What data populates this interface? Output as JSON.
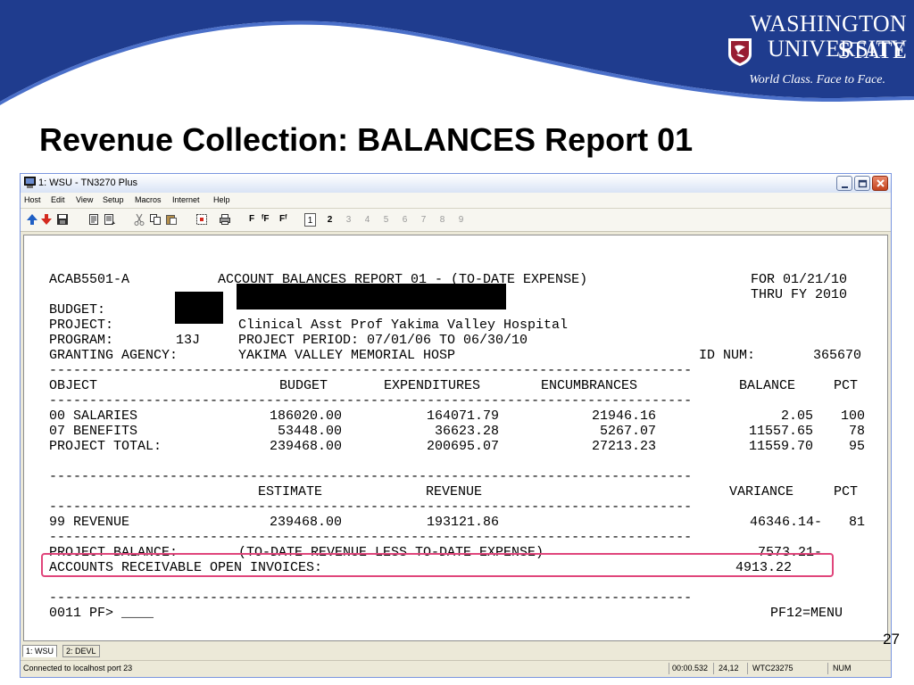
{
  "slide": {
    "title": "Revenue Collection: BALANCES Report 01",
    "page_number": "27",
    "logo": {
      "line1": "WASHINGTON STATE",
      "line2": "UNIVERSITY",
      "tagline": "World Class. Face to Face."
    },
    "colors": {
      "navy": "#1f3c8e",
      "crimson": "#981e32",
      "highlight": "#e0457b"
    }
  },
  "window": {
    "title": "1: WSU - TN3270 Plus",
    "menu": [
      "Host",
      "Edit",
      "View",
      "Setup",
      "Macros",
      "Internet",
      "Help"
    ],
    "toolbar": {
      "font_buttons": [
        "F",
        "ᶠF",
        "Fᶠ"
      ],
      "sessions": [
        "1",
        "2",
        "3",
        "4",
        "5",
        "6",
        "7",
        "8",
        "9"
      ]
    },
    "tabs": [
      "1: WSU",
      "2: DEVL"
    ],
    "status": {
      "connection": "Connected to localhost port 23",
      "time": "00:00.532",
      "cursor": "24,12",
      "device": "WTC23275",
      "numlock": "NUM"
    }
  },
  "terminal": {
    "header": {
      "report_id": "ACAB5501-A",
      "report_title": "ACCOUNT BALANCES REPORT 01 - (TO-DATE EXPENSE)",
      "for_date": "FOR 01/21/10",
      "thru": "THRU FY 2010"
    },
    "budget_label": "BUDGET:",
    "project_label": "PROJECT:",
    "project_desc": "Clinical Asst Prof Yakima Valley Hospital",
    "program_label": "PROGRAM:",
    "program_code": "13J",
    "project_period": "PROJECT PERIOD: 07/01/06 TO 06/30/10",
    "granting_label": "GRANTING AGENCY:",
    "granting_agency": "YAKIMA VALLEY MEMORIAL HOSP",
    "id_label": "ID NUM:",
    "id_num": "365670",
    "divider": "--------------------------------------------------------------------------------",
    "expense_columns": {
      "object": "OBJECT",
      "budget": "BUDGET",
      "expenditures": "EXPENDITURES",
      "encumbrances": "ENCUMBRANCES",
      "balance": "BALANCE",
      "pct": "PCT"
    },
    "expense_rows": [
      {
        "object": "00 SALARIES",
        "budget": "186020.00",
        "expenditures": "164071.79",
        "encumbrances": "21946.16",
        "balance": "2.05",
        "pct": "100"
      },
      {
        "object": "07 BENEFITS",
        "budget": "53448.00",
        "expenditures": "36623.28",
        "encumbrances": "5267.07",
        "balance": "11557.65",
        "pct": "78"
      },
      {
        "object": "PROJECT TOTAL:",
        "budget": "239468.00",
        "expenditures": "200695.07",
        "encumbrances": "27213.23",
        "balance": "11559.70",
        "pct": "95"
      }
    ],
    "revenue_columns": {
      "estimate": "ESTIMATE",
      "revenue": "REVENUE",
      "variance": "VARIANCE",
      "pct": "PCT"
    },
    "revenue_row": {
      "object": "99 REVENUE",
      "estimate": "239468.00",
      "revenue": "193121.86",
      "variance": "46346.14-",
      "pct": "81"
    },
    "project_balance_label": "PROJECT BALANCE:",
    "project_balance_desc": "(TO-DATE REVENUE LESS TO-DATE EXPENSE)",
    "project_balance_value": "7573.21-",
    "ar_label": "ACCOUNTS RECEIVABLE OPEN INVOICES:",
    "ar_value": "4913.22",
    "command_line": "0011 PF> ____",
    "pf12": "PF12=MENU"
  }
}
